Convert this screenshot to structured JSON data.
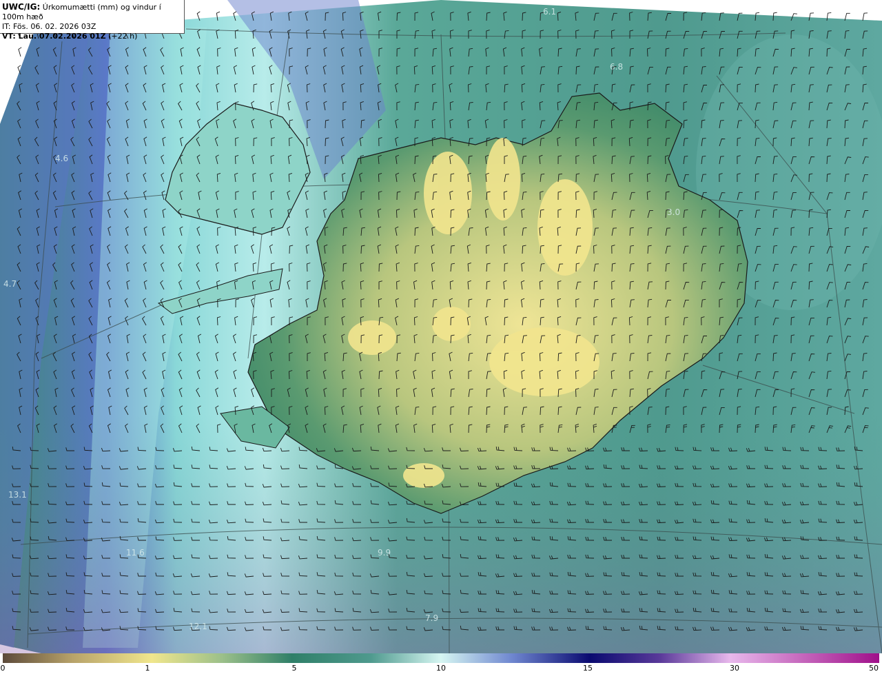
{
  "header": {
    "product": "UWC/IG:",
    "description": "Úrkomumætti (mm) og vindur í 100m hæð",
    "init_time": "IT: Fös. 06. 02. 2026 03Z",
    "valid_label": "VT: Lau. 07.02.2026 01Z",
    "valid_offset": "(+22 h)"
  },
  "map_labels": [
    "4.6",
    "4.7",
    "13.1",
    "11.6",
    "9.9",
    "7.9",
    "12.1",
    "3.0",
    "6.1",
    "6.8"
  ],
  "colorbar": {
    "ticks": [
      "0",
      "1",
      "5",
      "10",
      "15",
      "30",
      "50"
    ],
    "colors": [
      "#6b5a4a",
      "#c8b877",
      "#f0e68c",
      "#9cc08a",
      "#3f8f6f",
      "#2f6f60",
      "#7ac8c0",
      "#c8f4ee",
      "#8aa0d8",
      "#3a3aa8",
      "#10106a",
      "#6a4aa8",
      "#e0a0e0",
      "#a0108a"
    ]
  },
  "colors": {
    "ocean_teal": "#4f9a8e",
    "land_yellow": "#e8e08a",
    "land_green": "#4f8f6a",
    "blue_band": "#6f86d0",
    "purple_band": "#6a4aa8"
  }
}
